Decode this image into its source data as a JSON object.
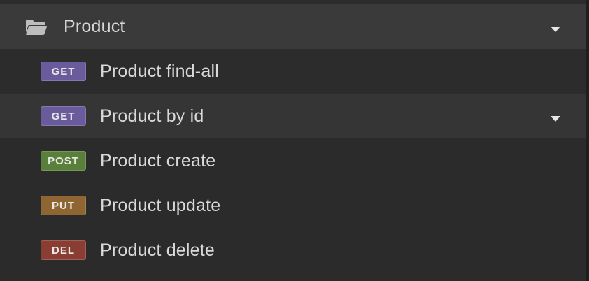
{
  "colors": {
    "get": "#6a5c9c",
    "post": "#5a7f3a",
    "put": "#8f6631",
    "del": "#8a3d33"
  },
  "folder": {
    "icon": "folder-open-icon",
    "label": "Product",
    "caret_icon": "chevron-down-icon"
  },
  "requests": [
    {
      "method": "GET",
      "label": "Product find-all"
    },
    {
      "method": "GET",
      "label": "Product by id",
      "caret_icon": "chevron-down-icon"
    },
    {
      "method": "POST",
      "label": "Product create"
    },
    {
      "method": "PUT",
      "label": "Product update"
    },
    {
      "method": "DEL",
      "label": "Product delete"
    }
  ]
}
